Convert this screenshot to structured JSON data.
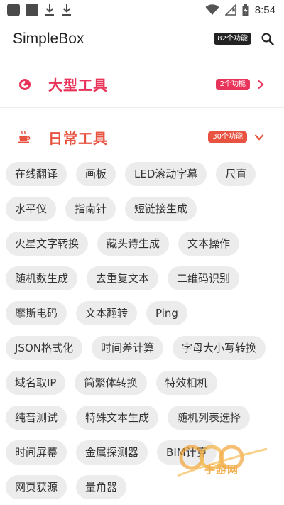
{
  "status_bar": {
    "time": "8:54"
  },
  "app_bar": {
    "title": "SimpleBox",
    "count_badge": "82个功能",
    "search_icon": "search-icon"
  },
  "sections": [
    {
      "title": "大型工具",
      "badge": "2个功能",
      "icon": "record-icon",
      "state": "collapsed",
      "color": "#e8345a"
    },
    {
      "title": "日常工具",
      "badge": "30个功能",
      "icon": "coffee-cup-icon",
      "state": "expanded",
      "color": "#e85240"
    }
  ],
  "chips": [
    [
      "在线翻译",
      "画板",
      "LED滚动字幕",
      "尺直"
    ],
    [
      "水平仪",
      "指南针",
      "短链接生成"
    ],
    [
      "火星文字转换",
      "藏头诗生成",
      "文本操作"
    ],
    [
      "随机数生成",
      "去重复文本",
      "二维码识别"
    ],
    [
      "摩斯电码",
      "文本翻转",
      "Ping"
    ],
    [
      "JSON格式化",
      "时间差计算",
      "字母大小写转换"
    ],
    [
      "域名取IP",
      "简繁体转换",
      "特效相机"
    ],
    [
      "纯音测试",
      "特殊文本生成",
      "随机列表选择"
    ],
    [
      "时间屏幕",
      "金属探测器",
      "BIM计算"
    ],
    [
      "网页获源",
      "量角器"
    ]
  ],
  "watermark": {
    "text": "手游网"
  }
}
